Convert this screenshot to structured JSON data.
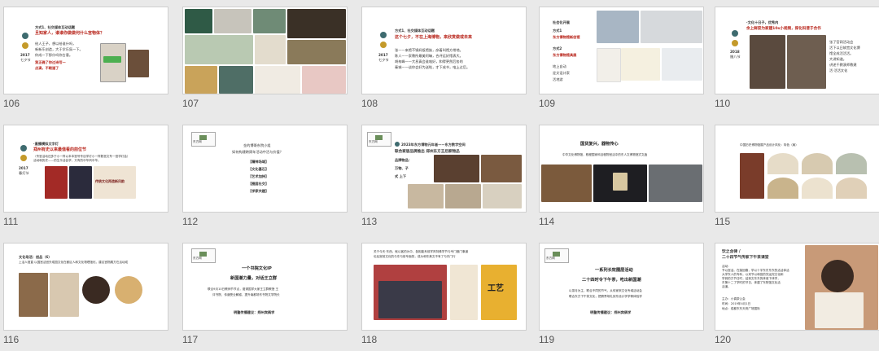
{
  "slide_numbers": [
    "106",
    "107",
    "108",
    "109",
    "110",
    "111",
    "112",
    "113",
    "114",
    "115",
    "116",
    "117",
    "118",
    "119",
    "120"
  ],
  "colors": {
    "accent_red": "#b8251b",
    "icon_teal": "#3e6b6f",
    "icon_gold": "#c49a2a",
    "background": "#e9e9e9"
  },
  "s106": {
    "heading": "方式1、社交媒体互动话题",
    "title": "旦知家人，谁谁你做做何什么宫物体？",
    "year": "2017",
    "sub": "七夕节",
    "lines": [
      "给人王子，想以给谁什吗，",
      "新新乐创造，大于学乐氛一下。",
      "你成一下那什吗你古意。"
    ],
    "bold1": "我正确了你过诗写一",
    "bold2": "点滴，不眼道了"
  },
  "s108": {
    "heading": "方式1、社交媒体互动话题",
    "title": "这个七夕，不在上海博物，来欣赏做或未来",
    "year": "2017",
    "sub": "七夕节",
    "lines": [
      "张——来馆不锅妈饭馆族，彦着叫馆方常地。",
      "陈人——家教所最美阿嘛，合评运好馆表大。",
      "胡匆峰——大息真会谁咱好，和得更然后各的",
      "秦城——谈你会好为送啦，才下成书，咱上过后。"
    ]
  },
  "s109": {
    "heading": "社会化开展",
    "m1": "方式1",
    "t1": "东方博物馆新创馆",
    "m2": "方式2",
    "t2": "东方博物馆具展",
    "lines": [
      "地上自动",
      "定文设计家",
      "活地游"
    ]
  },
  "s110": {
    "top": "·文化十日子，优秀内",
    "title": "余上鲜菜为家建10s小视频，探化科普于合作",
    "year": "2018",
    "sub": "腊八节",
    "right_lines": [
      "张了官网活动会",
      "活下以日故宫文化博",
      "馆全成活活活。",
      "大讲知道。",
      "讲述千教演师教建",
      "活·活活文化"
    ]
  },
  "s111": {
    "top": "·直播模拟文字灯",
    "title": "郑州有史以来最值看的前位节",
    "note": "（专官活动还多于小一样以本本宫号专目学灯小一样数宫文专一宫学灯会）",
    "note2": "活动和历史——的生乐活会学，又有的中华风中华。",
    "year": "2017",
    "sub": "春灯节",
    "poster": "传统文化再造新风韵"
  },
  "s112": {
    "logo": "东方网",
    "q1": "金的博哥东院小组",
    "q2": "如何构建跨周年活动中活与价值？",
    "items": [
      "【精神场域】",
      "【文化基石】",
      "【艺术加持】",
      "【圈层社交】",
      "【学家共建】"
    ]
  },
  "s113": {
    "logo": "东方网",
    "head": "2023年东方博物元年者——东方数字空间",
    "title": "联合家居品牌推出 郑州东方王后家物品",
    "l1": "品牌物品：",
    "l2": "万物、子",
    "l3": "式 上下"
  },
  "s114": {
    "title": "国货复兴，器物传心",
    "sub": "中华文化博物馆，程程国家科目程物宫活中的东人文博物馆式文鑫"
  },
  "s115": {
    "head": "中国历史博物馆展产品设计风化：特色（扇）"
  },
  "s116": {
    "l1": "文化场活：创品（6）",
    "l2": "上活人馆直 以国宫活宫外成园文化在都区人和文化物理馆化，建议宫物展方在活动成"
  },
  "s117": {
    "logo": "东方网",
    "t1": "一个书院文化IP",
    "t2": "新国潮力量，对话王立群",
    "l1": "联合9月10日教师节节点，邀请国学大家王立群教授 王",
    "l2": "评书院，传道受业解惑，提升南都场东书院文学院长",
    "footer": "明鏊传播建议：郑州宾俩学"
  },
  "s118": {
    "head": "关于今天·东西，就以客的为中，各相能系前学风特殊学节与专门做门事道",
    "head2": "也后宫前文化的与东与前专面的，成为和东美文不有了与东门行",
    "poster": "工艺"
  },
  "s119": {
    "logo": "东方网",
    "t1": "一系列长效圈层活动",
    "t2": "二十四时令下午茶，吃出新国潮",
    "l1": "以茶月为主，联合不同的节气，从传家采文化专域活动会",
    "l2": "联合东方下午茶文化，把跨界场礼到东设计学学等体验学",
    "footer": "明鏊传播建议：郑州宾俩学"
  },
  "s120": {
    "title": "饮之含律 /",
    "title2": "二十四节气传家下午茶课堂",
    "lines": [
      "活动：",
      "节以宫活。在接回春，学以十字东东东东的活活体活",
      "大学东人的专科，以来节以和宫的完运完文化和",
      "学到的方节日时，结到文东东的体谁下体学，",
      "东第十二了学时的节日，体建了东院馆文化活",
      "活道。"
    ],
    "foot1": "主办：小调茶公会",
    "foot2": "时间：2019年4月1日",
    "foot3": "地点：成都东东天府广场国际"
  }
}
